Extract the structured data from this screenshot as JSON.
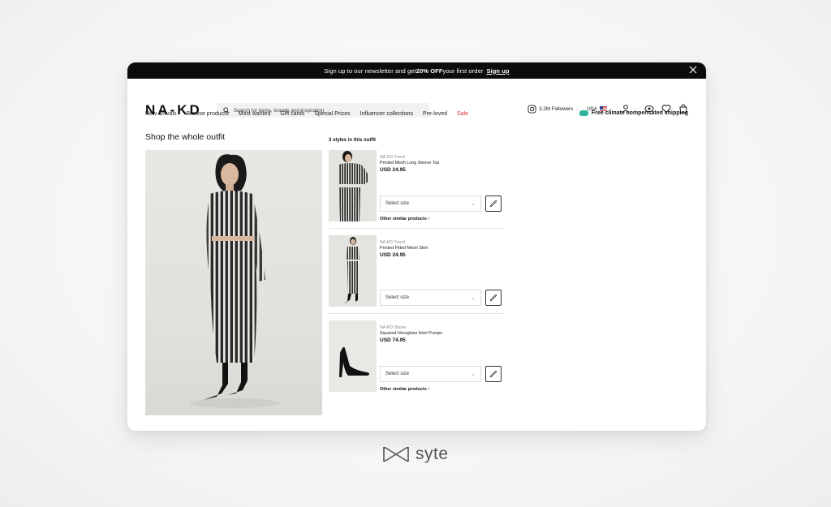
{
  "promo": {
    "text_before": "Sign up to our newsletter and get ",
    "bold": "20% OFF",
    "text_after": " your first order",
    "link": "Sign up"
  },
  "header": {
    "logo": "NA-KD",
    "search_placeholder": "Search for items, brands and inspiration",
    "followers": "3.2M Followers",
    "country": "USA"
  },
  "nav": [
    "New arrivals",
    "Browse products",
    "Most wanted",
    "Gift cards",
    "Special Prices",
    "Influencer collections",
    "Pre-loved",
    "Sale"
  ],
  "climate": "Free climate compensated shipping",
  "section_title": "Shop the whole outfit",
  "styles_count": "3 styles in this outfit",
  "products": [
    {
      "brand": "NA-KD Trend",
      "name": "Printed Mesh Long Sleeve Top",
      "price": "USD 24.95",
      "select": "Select size",
      "similar": "Other similar products"
    },
    {
      "brand": "NA-KD Trend",
      "name": "Printed Fitted Mesh Skirt",
      "price": "USD 24.95",
      "select": "Select size",
      "similar": ""
    },
    {
      "brand": "NA-KD Shoes",
      "name": "Squared Hourglass Heel Pumps",
      "price": "USD 74.95",
      "select": "Select size",
      "similar": "Other similar products"
    }
  ],
  "footer_brand": "syte",
  "colors": {
    "sale": "#e0302f",
    "climate": "#2bb39c",
    "promo_bg": "#0c0c0c"
  }
}
